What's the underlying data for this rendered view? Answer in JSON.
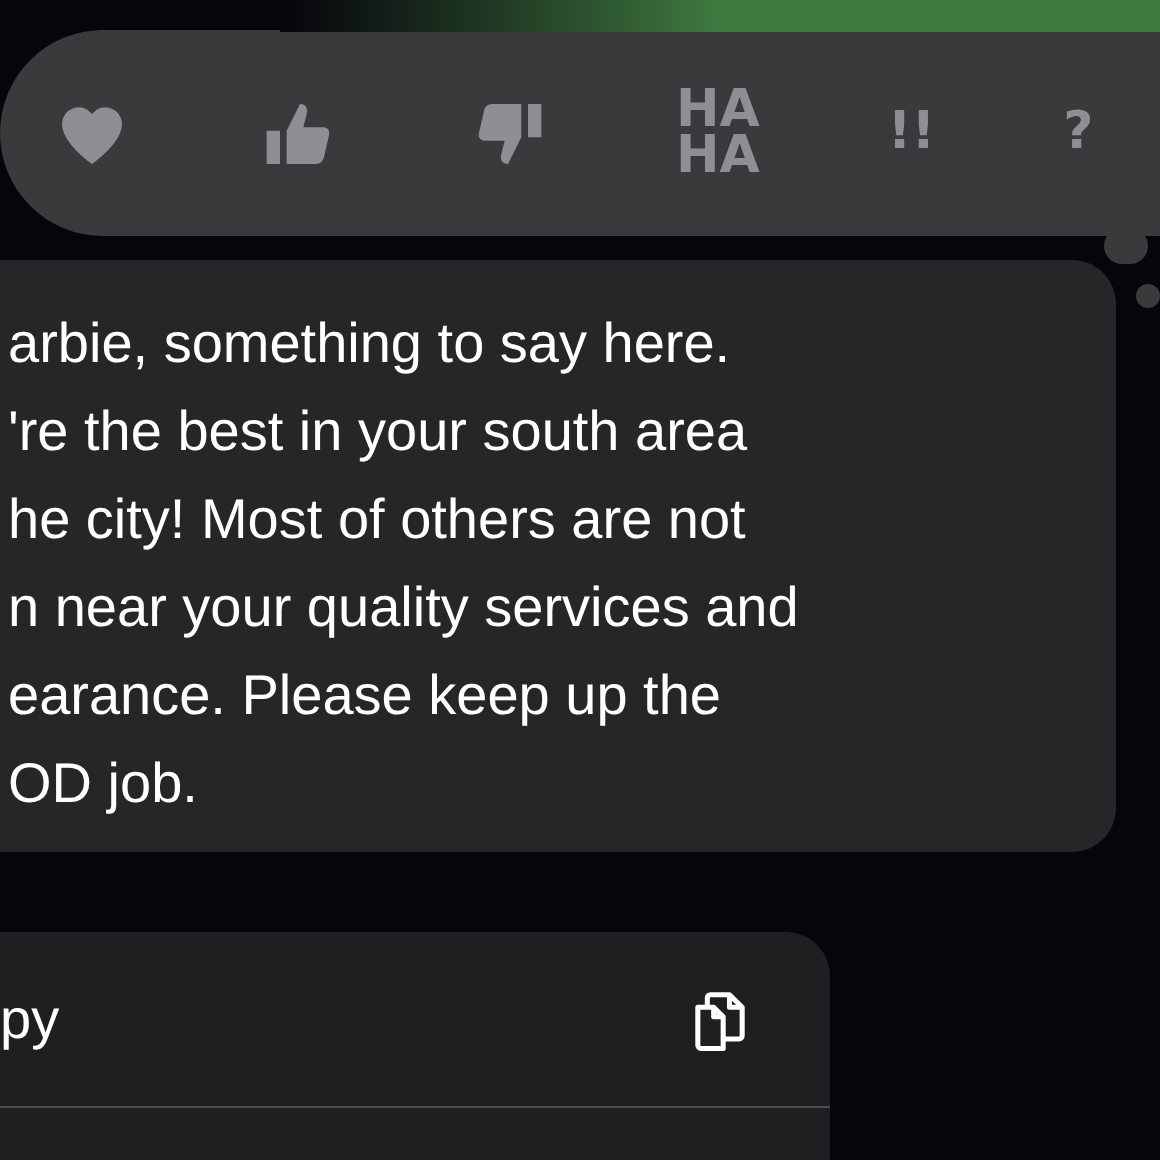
{
  "reactions": [
    {
      "kind": "heart"
    },
    {
      "kind": "thumbs-up"
    },
    {
      "kind": "thumbs-down"
    },
    {
      "kind": "text",
      "label": [
        "HA",
        "HA"
      ]
    },
    {
      "kind": "text",
      "label": [
        "!!"
      ]
    },
    {
      "kind": "text",
      "label": [
        "?"
      ]
    }
  ],
  "message": {
    "lines": [
      "arbie, something to say here.",
      "'re the best in your south area",
      "he city! Most of others are not",
      "n near your quality services and",
      "earance. Please keep up the",
      "OD job."
    ]
  },
  "menu": {
    "items": [
      {
        "label": "py"
      }
    ]
  }
}
